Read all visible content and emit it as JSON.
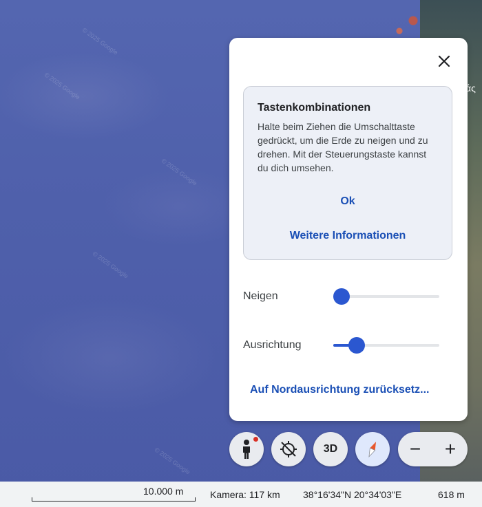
{
  "tip": {
    "title": "Tastenkombinationen",
    "text": "Halte beim Ziehen die Umschalttaste gedrückt, um die Erde zu neigen und zu drehen. Mit der Steuerungstaste kannst du dich umsehen.",
    "ok_label": "Ok",
    "more_label": "Weitere Informationen"
  },
  "sliders": {
    "tilt": {
      "label": "Neigen",
      "value": 0
    },
    "heading": {
      "label": "Ausrichtung",
      "value": 0.14
    }
  },
  "reset_label": "Auf Nordausrichtung zurücksetz...",
  "controls": {
    "threed_label": "3D",
    "zoom_out": "−",
    "zoom_in": "+"
  },
  "status": {
    "scale": "10.000 m",
    "camera": "Kamera: 117 km",
    "coords": "38°16'34\"N 20°34'03\"E",
    "elevation": "618 m"
  },
  "map": {
    "watermark": "© 2025 Google",
    "label_fragment": "άς"
  },
  "colors": {
    "accent": "#1a4fb5",
    "slider": "#2b57d0",
    "notification_dot": "#d93025"
  }
}
